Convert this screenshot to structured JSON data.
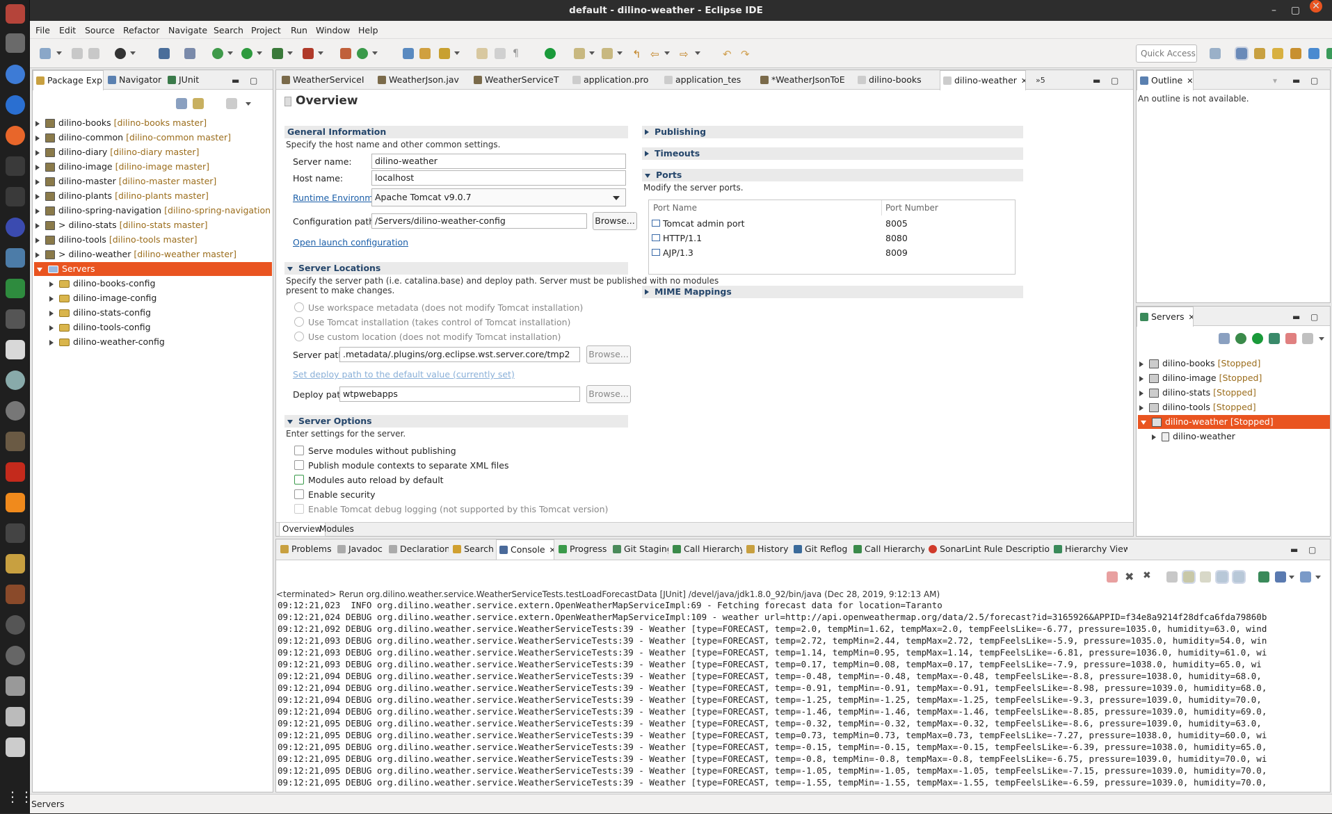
{
  "window": {
    "title": "default - dilino-weather - Eclipse IDE"
  },
  "menu": [
    "File",
    "Edit",
    "Source",
    "Refactor",
    "Navigate",
    "Search",
    "Project",
    "Run",
    "Window",
    "Help"
  ],
  "quick_access": "Quick Access",
  "left_panel": {
    "tabs": [
      "Package Explo",
      "Navigator",
      "JUnit"
    ],
    "projects": [
      {
        "name": "dilino-books",
        "branch": "[dilino-books master]"
      },
      {
        "name": "dilino-common",
        "branch": "[dilino-common master]"
      },
      {
        "name": "dilino-diary",
        "branch": "[dilino-diary master]"
      },
      {
        "name": "dilino-image",
        "branch": "[dilino-image master]"
      },
      {
        "name": "dilino-master",
        "branch": "[dilino-master master]"
      },
      {
        "name": "dilino-plants",
        "branch": "[dilino-plants master]"
      },
      {
        "name": "dilino-spring-navigation",
        "branch": "[dilino-spring-navigation maste"
      },
      {
        "name": "> dilino-stats",
        "branch": "[dilino-stats master]"
      },
      {
        "name": "dilino-tools",
        "branch": "[dilino-tools master]"
      },
      {
        "name": "> dilino-weather",
        "branch": "[dilino-weather master]"
      }
    ],
    "servers_folder": "Servers",
    "server_configs": [
      "dilino-books-config",
      "dilino-image-config",
      "dilino-stats-config",
      "dilino-tools-config",
      "dilino-weather-config"
    ]
  },
  "editor": {
    "tabs": [
      "WeatherServiceI",
      "WeatherJson.jav",
      "WeatherServiceT",
      "application.pro",
      "application_tes",
      "*WeatherJsonToE",
      "dilino-books",
      "dilino-weather"
    ],
    "overflow": "»5",
    "title": "Overview",
    "general": {
      "header": "General Information",
      "desc": "Specify the host name and other common settings.",
      "server_name_label": "Server name:",
      "server_name": "dilino-weather",
      "host_name_label": "Host name:",
      "host_name": "localhost",
      "runtime_label": "Runtime Environment:",
      "runtime": "Apache Tomcat v9.0.7",
      "config_label": "Configuration path:",
      "config": "/Servers/dilino-weather-config",
      "browse": "Browse...",
      "open_launch": "Open launch configuration"
    },
    "locations": {
      "header": "Server Locations",
      "desc1": "Specify the server path (i.e. catalina.base) and deploy path. Server must be published with no modules",
      "desc2": "present to make changes.",
      "options": [
        "Use workspace metadata (does not modify Tomcat installation)",
        "Use Tomcat installation (takes control of Tomcat installation)",
        "Use custom location (does not modify Tomcat installation)"
      ],
      "server_path_label": "Server path:",
      "server_path": ".metadata/.plugins/org.eclipse.wst.server.core/tmp2",
      "set_deploy": "Set deploy path to the default value (currently set)",
      "deploy_label": "Deploy path:",
      "deploy": "wtpwebapps",
      "browse": "Browse..."
    },
    "options": {
      "header": "Server Options",
      "desc": "Enter settings for the server.",
      "items": [
        "Serve modules without publishing",
        "Publish module contexts to separate XML files",
        "Modules auto reload by default",
        "Enable security",
        "Enable Tomcat debug logging (not supported by this Tomcat version)"
      ]
    },
    "right": {
      "publishing": "Publishing",
      "timeouts": "Timeouts",
      "ports": "Ports",
      "ports_desc": "Modify the server ports.",
      "col_name": "Port Name",
      "col_num": "Port Number",
      "rows": [
        {
          "name": "Tomcat admin port",
          "num": "8005"
        },
        {
          "name": "HTTP/1.1",
          "num": "8080"
        },
        {
          "name": "AJP/1.3",
          "num": "8009"
        }
      ],
      "mime": "MIME Mappings"
    },
    "bottom_tabs": [
      "Overview",
      "Modules"
    ]
  },
  "outline": {
    "tab": "Outline",
    "msg": "An outline is not available."
  },
  "servers_view": {
    "tab": "Servers",
    "items": [
      {
        "name": "dilino-books",
        "state": "[Stopped]"
      },
      {
        "name": "dilino-image",
        "state": "[Stopped]"
      },
      {
        "name": "dilino-stats",
        "state": "[Stopped]"
      },
      {
        "name": "dilino-tools",
        "state": "[Stopped]"
      },
      {
        "name": "dilino-weather",
        "state": "[Stopped]"
      }
    ],
    "child": "dilino-weather"
  },
  "console": {
    "tabs": [
      "Problems",
      "Javadoc",
      "Declaration",
      "Search",
      "Console",
      "Progress",
      "Git Staging",
      "Call Hierarchy",
      "History",
      "Git Reflog",
      "Call Hierarchy",
      "SonarLint Rule Description",
      "Hierarchy View"
    ],
    "header": "<terminated> Rerun org.dilino.weather.service.WeatherServiceTests.testLoadForecastData [JUnit] /devel/java/jdk1.8.0_92/bin/java (Dec 28, 2019, 9:12:13 AM)",
    "lines": [
      "09:12:21,023  INFO org.dilino.weather.service.extern.OpenWeatherMapServiceImpl:69 - Fetching forecast data for location=Taranto",
      "09:12:21,024 DEBUG org.dilino.weather.service.extern.OpenWeatherMapServiceImpl:109 - weather url=http://api.openweathermap.org/data/2.5/forecast?id=3165926&APPID=f34e8a9214f28dfca6fda79860b",
      "09:12:21,092 DEBUG org.dilino.weather.service.WeatherServiceTests:39 - Weather [type=FORECAST, temp=2.0, tempMin=1.62, tempMax=2.0, tempFeelsLike=-6.77, pressure=1035.0, humidity=63.0, wind",
      "09:12:21,093 DEBUG org.dilino.weather.service.WeatherServiceTests:39 - Weather [type=FORECAST, temp=2.72, tempMin=2.44, tempMax=2.72, tempFeelsLike=-5.9, pressure=1035.0, humidity=54.0, win",
      "09:12:21,093 DEBUG org.dilino.weather.service.WeatherServiceTests:39 - Weather [type=FORECAST, temp=1.14, tempMin=0.95, tempMax=1.14, tempFeelsLike=-6.81, pressure=1036.0, humidity=61.0, wi",
      "09:12:21,093 DEBUG org.dilino.weather.service.WeatherServiceTests:39 - Weather [type=FORECAST, temp=0.17, tempMin=0.08, tempMax=0.17, tempFeelsLike=-7.9, pressure=1038.0, humidity=65.0, wi",
      "09:12:21,094 DEBUG org.dilino.weather.service.WeatherServiceTests:39 - Weather [type=FORECAST, temp=-0.48, tempMin=-0.48, tempMax=-0.48, tempFeelsLike=-8.8, pressure=1038.0, humidity=68.0,",
      "09:12:21,094 DEBUG org.dilino.weather.service.WeatherServiceTests:39 - Weather [type=FORECAST, temp=-0.91, tempMin=-0.91, tempMax=-0.91, tempFeelsLike=-8.98, pressure=1039.0, humidity=68.0,",
      "09:12:21,094 DEBUG org.dilino.weather.service.WeatherServiceTests:39 - Weather [type=FORECAST, temp=-1.25, tempMin=-1.25, tempMax=-1.25, tempFeelsLike=-9.3, pressure=1039.0, humidity=70.0,",
      "09:12:21,094 DEBUG org.dilino.weather.service.WeatherServiceTests:39 - Weather [type=FORECAST, temp=-1.46, tempMin=-1.46, tempMax=-1.46, tempFeelsLike=-8.85, pressure=1039.0, humidity=69.0,",
      "09:12:21,095 DEBUG org.dilino.weather.service.WeatherServiceTests:39 - Weather [type=FORECAST, temp=-0.32, tempMin=-0.32, tempMax=-0.32, tempFeelsLike=-8.6, pressure=1039.0, humidity=63.0,",
      "09:12:21,095 DEBUG org.dilino.weather.service.WeatherServiceTests:39 - Weather [type=FORECAST, temp=0.73, tempMin=0.73, tempMax=0.73, tempFeelsLike=-7.27, pressure=1038.0, humidity=60.0, wi",
      "09:12:21,095 DEBUG org.dilino.weather.service.WeatherServiceTests:39 - Weather [type=FORECAST, temp=-0.15, tempMin=-0.15, tempMax=-0.15, tempFeelsLike=-6.39, pressure=1038.0, humidity=65.0,",
      "09:12:21,095 DEBUG org.dilino.weather.service.WeatherServiceTests:39 - Weather [type=FORECAST, temp=-0.8, tempMin=-0.8, tempMax=-0.8, tempFeelsLike=-6.75, pressure=1039.0, humidity=70.0, wi",
      "09:12:21,095 DEBUG org.dilino.weather.service.WeatherServiceTests:39 - Weather [type=FORECAST, temp=-1.05, tempMin=-1.05, tempMax=-1.05, tempFeelsLike=-7.15, pressure=1039.0, humidity=70.0,",
      "09:12:21,095 DEBUG org.dilino.weather.service.WeatherServiceTests:39 - Weather [type=FORECAST, temp=-1.55, tempMin=-1.55, tempMax=-1.55, tempFeelsLike=-6.59, pressure=1039.0, humidity=70.0,"
    ]
  },
  "status": "Servers",
  "colors": {
    "selection": "#e95420",
    "decoration": "#9b6d1c",
    "section": "#25466b",
    "link": "#1a5ea8"
  }
}
